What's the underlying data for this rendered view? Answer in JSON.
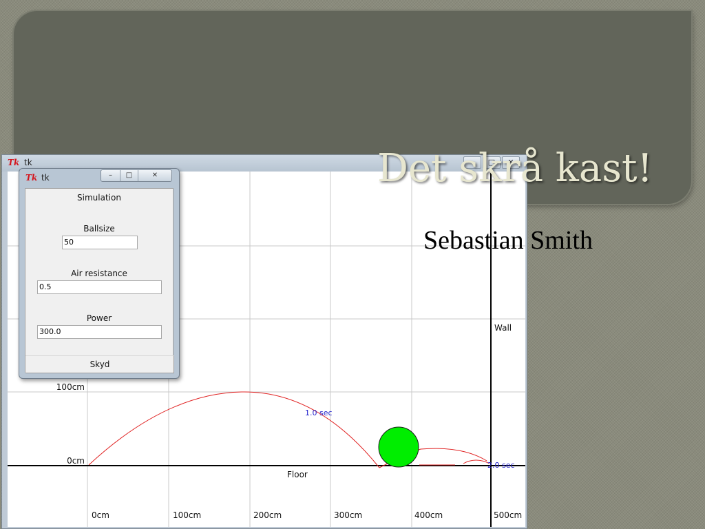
{
  "slide": {
    "title": "Det skrå kast!",
    "subtitle": "Sebastian Smith"
  },
  "main_window": {
    "title": "tk",
    "logo": "Tk",
    "controls": [
      "minimize-icon",
      "maximize-icon",
      "close-icon"
    ],
    "canvas": {
      "x_labels": [
        "0cm",
        "100cm",
        "200cm",
        "300cm",
        "400cm",
        "500cm"
      ],
      "y_labels": [
        "100cm",
        "0cm"
      ],
      "floor_label": "Floor",
      "wall_label": "Wall",
      "time_markers": [
        "1.0 sec",
        "2.0 sec"
      ],
      "colors": {
        "trajectory": "#e02020",
        "ball": "#00ee00",
        "time_marker": "#2222cc",
        "grid": "#c8c8c8"
      }
    }
  },
  "control_window": {
    "title": "tk",
    "logo": "Tk",
    "controls": [
      "minimize-icon",
      "maximize-icon",
      "close-icon"
    ],
    "heading": "Simulation",
    "fields": {
      "ballsize": {
        "label": "Ballsize",
        "value": "50"
      },
      "air_resistance": {
        "label": "Air resistance",
        "value": "0.5"
      },
      "power": {
        "label": "Power",
        "value": "300.0"
      }
    },
    "submit_label": "Skyd"
  }
}
